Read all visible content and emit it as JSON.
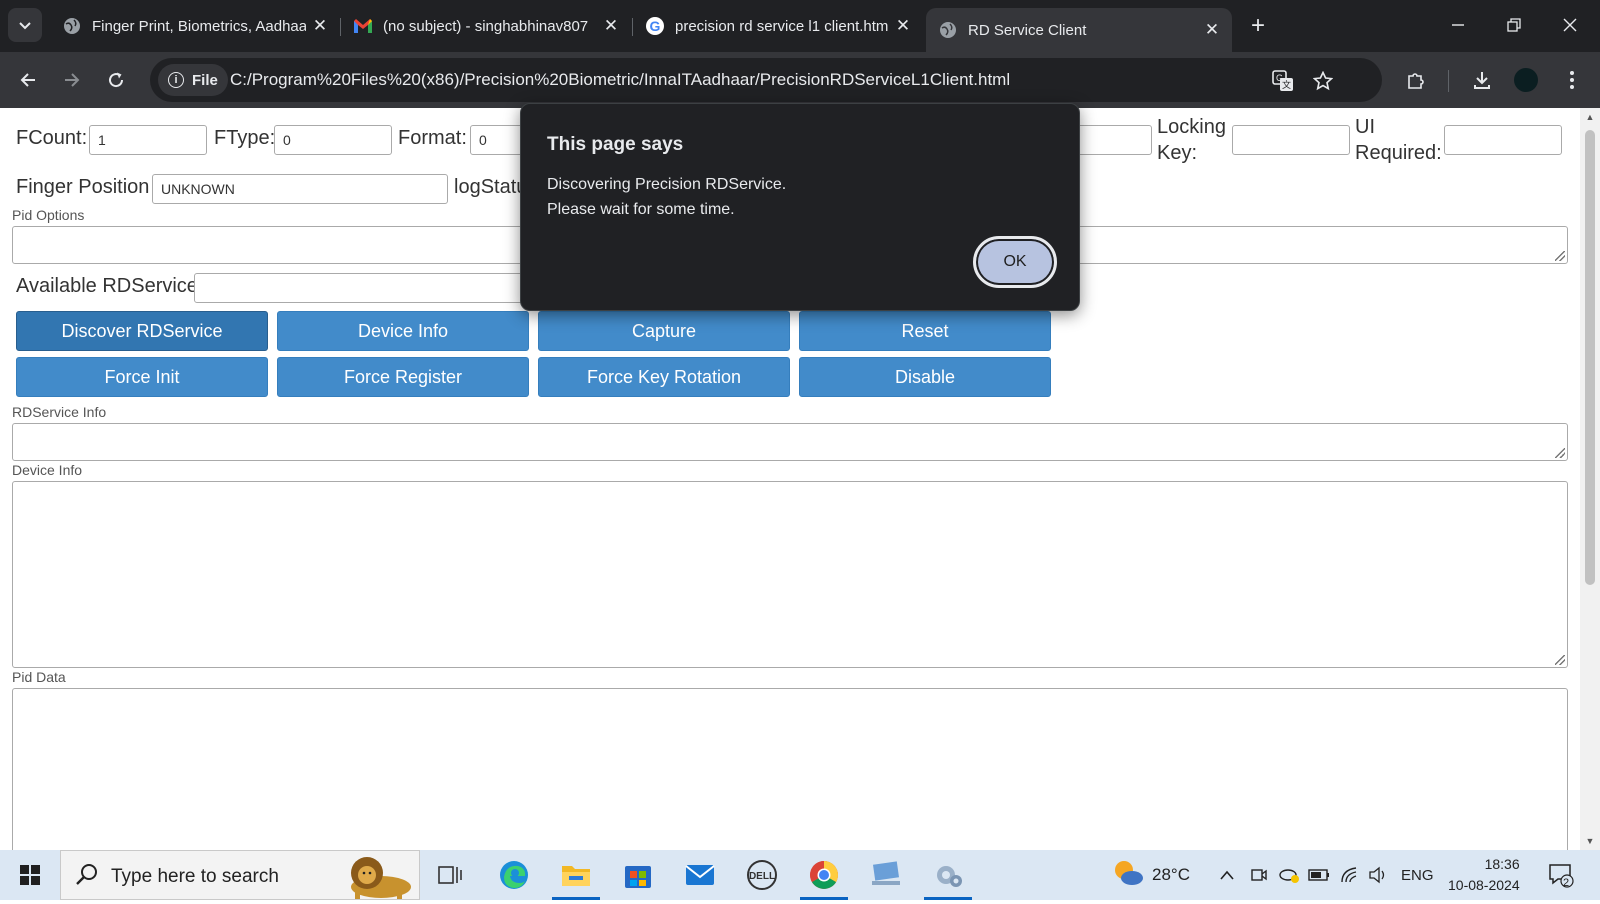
{
  "browser": {
    "tabs": [
      {
        "title": "Finger Print, Biometrics, Aadhaa",
        "icon": "globe-icon"
      },
      {
        "title": "(no subject) - singhabhinav807",
        "icon": "gmail-icon"
      },
      {
        "title": "precision rd service l1 client.htm",
        "icon": "google-icon"
      },
      {
        "title": "RD Service Client",
        "icon": "globe-icon",
        "active": true
      }
    ],
    "chip_label": "File",
    "url": "C:/Program%20Files%20(x86)/Precision%20Biometric/InnaITAadhaar/PrecisionRDServiceL1Client.html"
  },
  "form": {
    "fcount_label": "FCount:",
    "fcount_value": "1",
    "ftype_label": "FType:",
    "ftype_value": "0",
    "format_label": "Format:",
    "format_value": "0",
    "locking_key_label_1": "Locking",
    "locking_key_label_2": "Key:",
    "ui_required_label_1": "UI",
    "ui_required_label_2": "Required:",
    "finger_position_label": "Finger Position",
    "finger_position_value": "UNKNOWN",
    "logstatus_label": "logStatu",
    "pid_options_label": "Pid Options",
    "available_rdservice_label": "Available RDService",
    "rdservice_info_label": "RDService Info",
    "device_info_label": "Device Info",
    "pid_data_label": "Pid Data"
  },
  "buttons": {
    "discover": "Discover RDService",
    "device_info": "Device Info",
    "capture": "Capture",
    "reset": "Reset",
    "force_init": "Force Init",
    "force_register": "Force Register",
    "force_key_rotation": "Force Key Rotation",
    "disable": "Disable"
  },
  "dialog": {
    "title": "This page says",
    "line1": "Discovering Precision RDService.",
    "line2": "Please wait for some time.",
    "ok_label": "OK"
  },
  "taskbar": {
    "search_placeholder": "Type here to search",
    "temperature": "28°C",
    "language": "ENG",
    "time": "18:36",
    "date": "10-08-2024",
    "notification_count": "2"
  },
  "colors": {
    "button_blue": "#428bca",
    "chrome_dark": "#202124",
    "taskbar": "#dbe7f3"
  }
}
